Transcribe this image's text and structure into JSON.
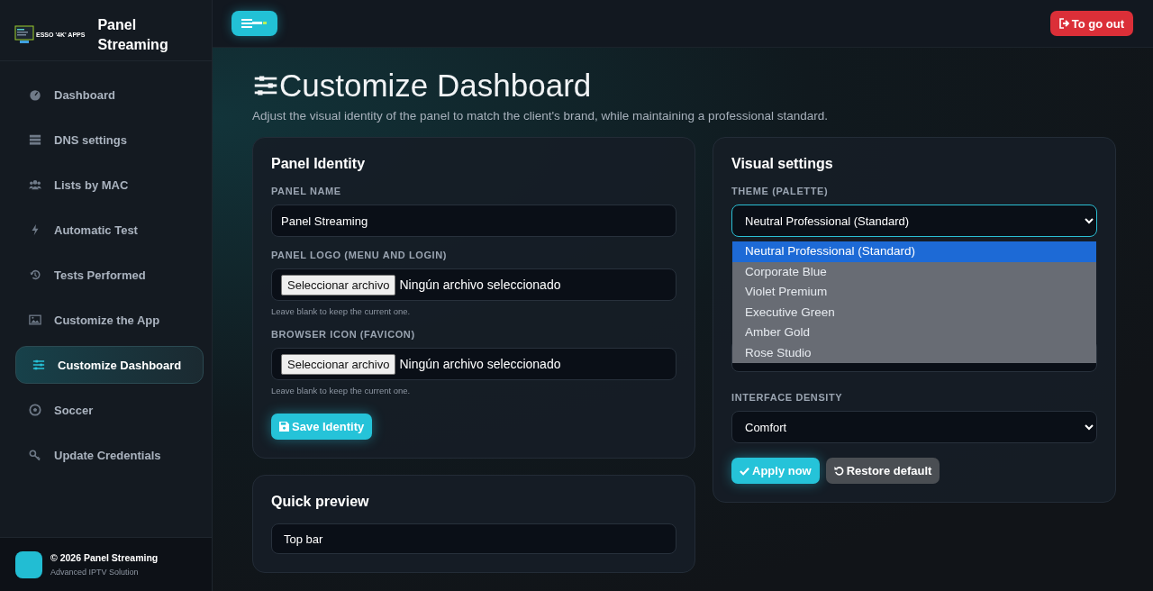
{
  "sidebar": {
    "logo_text": "ESSO '4K' APPS",
    "title": "Panel Streaming",
    "items": [
      {
        "label": "Dashboard",
        "selected": false
      },
      {
        "label": "DNS settings",
        "selected": false
      },
      {
        "label": "Lists by MAC",
        "selected": false
      },
      {
        "label": "Automatic Test",
        "selected": false
      },
      {
        "label": "Tests Performed",
        "selected": false
      },
      {
        "label": "Customize the App",
        "selected": false
      },
      {
        "label": "Customize Dashboard",
        "selected": true
      },
      {
        "label": "Soccer",
        "selected": false
      },
      {
        "label": "Update Credentials",
        "selected": false
      }
    ],
    "footer": {
      "copyright": "© 2026 Panel Streaming",
      "subtitle": "Advanced IPTV Solution"
    }
  },
  "topbar": {
    "logout": "To go out"
  },
  "page": {
    "title": "Customize Dashboard",
    "subtitle": "Adjust the visual identity of the panel to match the client's brand, while maintaining a professional standard."
  },
  "identity": {
    "title": "Panel Identity",
    "fields": [
      {
        "kind": "text",
        "label": "PANEL NAME",
        "value": "Panel Streaming"
      },
      {
        "kind": "file",
        "label": "PANEL LOGO (MENU AND LOGIN)",
        "button": "Seleccionar archivo",
        "status": "Ningún archivo seleccionado",
        "hint": "Leave blank to keep the current one."
      },
      {
        "kind": "file",
        "label": "BROWSER ICON (FAVICON)",
        "button": "Seleccionar archivo",
        "status": "Ningún archivo seleccionado",
        "hint": "Leave blank to keep the current one."
      }
    ],
    "save": "Save Identity"
  },
  "visual": {
    "title": "Visual settings",
    "theme": {
      "label": "THEME (PALETTE)",
      "value": "Neutral Professional (Standard)",
      "expanded": true,
      "options": [
        {
          "label": "Neutral Professional (Standard)",
          "selected": true
        },
        {
          "label": "Corporate Blue",
          "selected": false
        },
        {
          "label": "Violet Premium",
          "selected": false
        },
        {
          "label": "Executive Green",
          "selected": false
        },
        {
          "label": "Amber Gold",
          "selected": false
        },
        {
          "label": "Rose Studio",
          "selected": false
        }
      ]
    },
    "density": {
      "label": "INTERFACE DENSITY",
      "value": "Comfort"
    },
    "apply": "Apply now",
    "restore": "Restore default"
  },
  "preview": {
    "title": "Quick preview",
    "top_bar": "Top bar"
  }
}
